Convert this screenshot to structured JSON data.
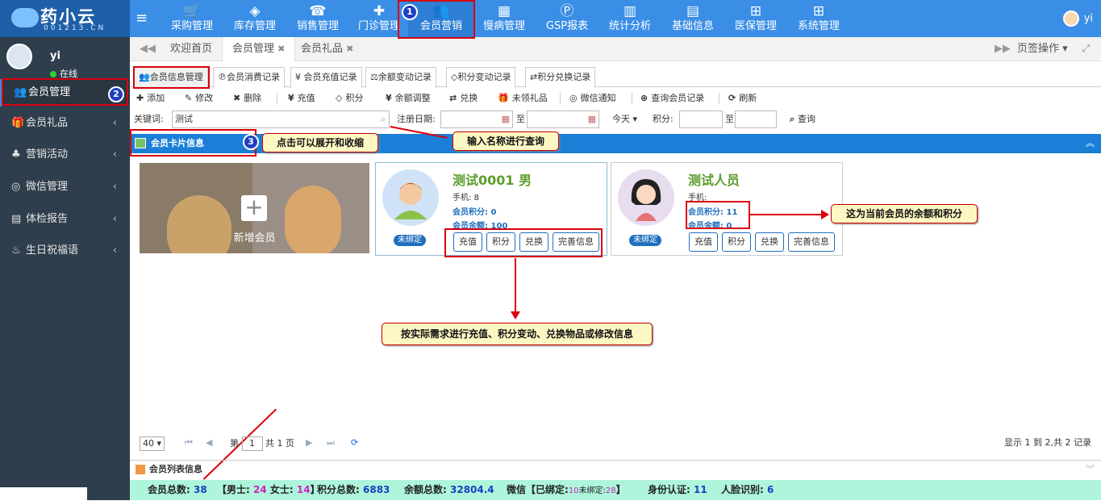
{
  "brand": {
    "name": "药小云",
    "sub": "001213.CN"
  },
  "nav": [
    {
      "icon": "cart-icon",
      "glyph": "🛒",
      "label": "采购管理"
    },
    {
      "icon": "cube-icon",
      "glyph": "◈",
      "label": "库存管理"
    },
    {
      "icon": "phone-icon",
      "glyph": "☎",
      "label": "销售管理"
    },
    {
      "icon": "medkit-icon",
      "glyph": "✚",
      "label": "门诊管理"
    },
    {
      "icon": "users-icon",
      "glyph": "👥",
      "label": "会员营销"
    },
    {
      "icon": "hospital-icon",
      "glyph": "▦",
      "label": "慢病管理"
    },
    {
      "icon": "gsp-icon",
      "glyph": "Ⓟ",
      "label": "GSP报表"
    },
    {
      "icon": "chart-icon",
      "glyph": "▥",
      "label": "统计分析"
    },
    {
      "icon": "book-icon",
      "glyph": "▤",
      "label": "基础信息"
    },
    {
      "icon": "windows-icon",
      "glyph": "⊞",
      "label": "医保管理"
    },
    {
      "icon": "windows-icon",
      "glyph": "⊞",
      "label": "系统管理"
    }
  ],
  "top_user": "yi",
  "sidebar": {
    "user": "yi",
    "status": "在线",
    "items": [
      {
        "glyph": "👥",
        "label": "会员管理"
      },
      {
        "glyph": "🎁",
        "label": "会员礼品"
      },
      {
        "glyph": "♣",
        "label": "营销活动"
      },
      {
        "glyph": "◎",
        "label": "微信管理"
      },
      {
        "glyph": "▤",
        "label": "体检报告"
      },
      {
        "glyph": "♨",
        "label": "生日祝福语"
      }
    ],
    "chevron": "‹"
  },
  "tabs": {
    "back": "◀◀",
    "fwd": "▶▶",
    "items": [
      "欢迎首页",
      "会员管理",
      "会员礼品"
    ],
    "close": "✖",
    "ops": "页签操作",
    "expand": "⤢"
  },
  "subtabs": [
    "会员信息管理",
    "会员消费记录",
    "¥ 会员充值记录",
    "余额变动记录",
    "积分变动记录",
    "积分兑换记录"
  ],
  "toolbar": [
    "添加",
    "修改",
    "删除",
    "充值",
    "积分",
    "余额调整",
    "兑换",
    "未领礼品",
    "微信通知",
    "查询会员记录",
    "刷新"
  ],
  "search": {
    "kw_label": "关键词:",
    "kw_value": "测试",
    "date_label": "注册日期:",
    "to": "至",
    "today": "今天",
    "points_label": "积分:",
    "query": "查询"
  },
  "panel": {
    "title": "会员卡片信息",
    "up": "︽"
  },
  "add_card": {
    "label": "新增会员"
  },
  "members": [
    {
      "name": "测试0001 男",
      "phone_label": "手机:",
      "phone": "8",
      "points_label": "会员积分:",
      "points": "0",
      "balance_label": "会员余额:",
      "balance": "100",
      "badge": "未绑定"
    },
    {
      "name": "测试人员",
      "phone_label": "手机:",
      "phone": "",
      "points_label": "会员积分:",
      "points": "11",
      "balance_label": "会员余额:",
      "balance": "0",
      "badge": "未绑定"
    }
  ],
  "card_buttons": [
    "充值",
    "积分",
    "兑换",
    "完善信息"
  ],
  "annotations": {
    "n1": "1",
    "n2": "2",
    "n3": "3",
    "c_toggle": "点击可以展开和收缩",
    "c_search": "输入名称进行查询",
    "c_balance": "这为当前会员的余额和积分",
    "c_actions": "按实际需求进行充值、积分变动、兑换物品或修改信息"
  },
  "pager": {
    "size": "40",
    "page_pre": "第",
    "page": "1",
    "page_post": "共 1 页",
    "summary": "显示 1 到 2,共 2 记录"
  },
  "list": {
    "title": "会员列表信息",
    "down": "︾"
  },
  "footer": {
    "total_label": "会员总数:",
    "total": "38",
    "male_label": "【男士:",
    "male": "24",
    "female_label": "女士:",
    "female": "14",
    "close": "】",
    "points_label": "积分总数:",
    "points": "6883",
    "balance_label": "余额总数:",
    "balance": "32804.4",
    "wx_label": "微信【已绑定:",
    "wx_bound": "10",
    "wx_unbound_label": "未绑定:",
    "wx_unbound": "28",
    "id_label": "身份认证:",
    "id": "11",
    "face_label": "人脸识别:",
    "face": "6"
  }
}
